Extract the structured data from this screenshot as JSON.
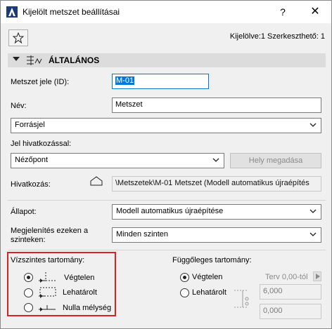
{
  "window": {
    "title": "Kijelölt metszet beállításai",
    "help": "?",
    "close": "✕"
  },
  "toolbar": {
    "selection_info": "Kijelölve:1 Szerkeszthető: 1"
  },
  "section": {
    "title": "ÁLTALÁNOS"
  },
  "fields": {
    "id_label": "Metszet jele (ID):",
    "id_value": "M-01",
    "name_label": "Név:",
    "name_value": "Metszet",
    "source_marker": "Forrásjel",
    "marker_ref_label": "Jel hivatkozással:",
    "marker_ref_value": "Nézőpont",
    "set_location_button": "Hely megadása",
    "reference_label": "Hivatkozás:",
    "reference_value": "\\Metszetek\\M-01 Metszet (Modell automatikus újraépítés",
    "status_label": "Állapot:",
    "status_value": "Modell automatikus újraépítése",
    "show_on_label_line1": "Megjelenítés ezeken a",
    "show_on_label_line2": "szinteken:",
    "show_on_value": "Minden szinten"
  },
  "horizontal_range": {
    "title": "Vízszintes tartomány:",
    "options": [
      {
        "label": "Végtelen",
        "selected": true
      },
      {
        "label": "Lehatárolt",
        "selected": false
      },
      {
        "label": "Nulla mélység",
        "selected": false
      }
    ]
  },
  "vertical_range": {
    "title": "Függőleges tartomány:",
    "options": [
      {
        "label": "Végtelen",
        "selected": true
      },
      {
        "label": "Lehatárolt",
        "selected": false
      }
    ],
    "plan_label": "Terv 0,00-tól",
    "top_value": "6,000",
    "bottom_value": "0,000"
  }
}
